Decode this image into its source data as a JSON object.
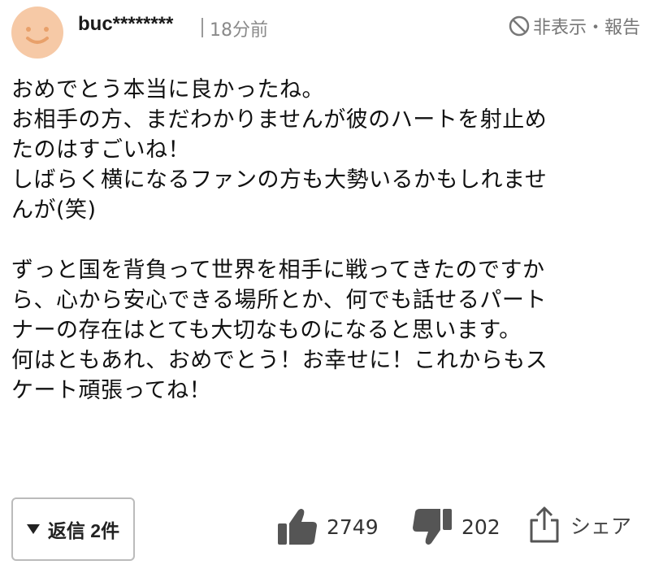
{
  "comment": {
    "username": "buc********",
    "time": "18分前",
    "hide_report": "非表示・報告",
    "paragraph1": "おめでとう本当に良かったね。\nお相手の方、まだわかりませんが彼のハートを射止め\nたのはすごいね！\nしばらく横になるファンの方も大勢いるかもしれませ\nんが(笑)",
    "paragraph2": "ずっと国を背負って世界を相手に戦ってきたのですか\nら、心から安心できる場所とか、何でも話せるパート\nナーの存在はとても大切なものになると思います。\n何はともあれ、おめでとう！お幸せに！これからもス\nケート頑張ってね！"
  },
  "footer": {
    "reply_label": "返信 2件",
    "like_count": "2749",
    "dislike_count": "202",
    "share_label": "シェア"
  },
  "icons": {
    "avatar": "smiley-avatar-icon",
    "hide": "ban-icon",
    "reply_toggle": "triangle-down-icon",
    "like": "thumbs-up-icon",
    "dislike": "thumbs-down-icon",
    "share": "share-icon"
  },
  "colors": {
    "avatar_bg": "#f6c9a6",
    "avatar_face": "#e8a06a",
    "muted_text": "#8a8a8a",
    "icon_gray": "#555555"
  }
}
